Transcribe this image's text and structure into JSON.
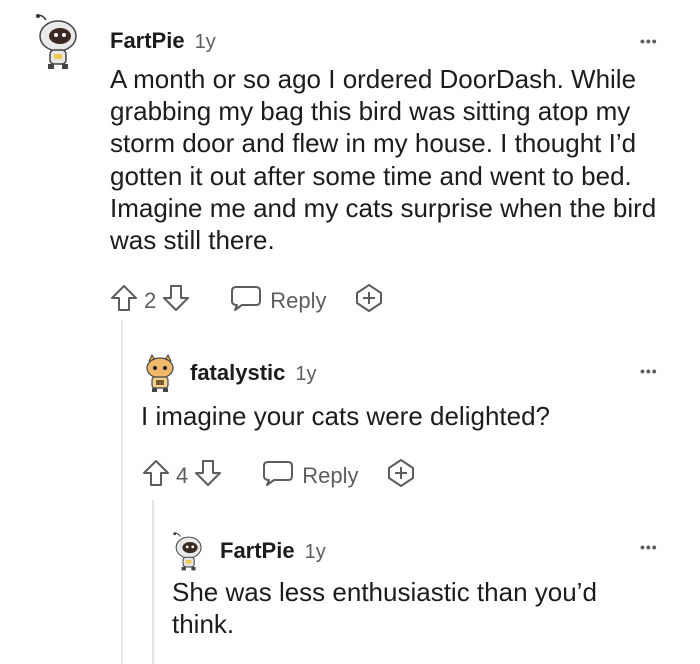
{
  "comments": [
    {
      "username": "FartPie",
      "age": "1y",
      "body": "A month or so ago I ordered DoorDash. While grabbing my bag this bird was sitting atop my storm door and flew in my house. I thought I’d gotten it out after some time and went to bed. Imagine me and my cats surprise when the bird was still there.",
      "votes": "2",
      "reply_label": "Reply",
      "more_label": "•••"
    },
    {
      "username": "fatalystic",
      "age": "1y",
      "body": "I imagine your cats were delighted?",
      "votes": "4",
      "reply_label": "Reply",
      "more_label": "•••"
    },
    {
      "username": "FartPie",
      "age": "1y",
      "body": "She was less enthusiastic than you’d think.",
      "more_label": "•••"
    }
  ],
  "colors": {
    "text": "#1c1c1c",
    "muted": "#5d5d5d",
    "thread_line": "#e5e5e5"
  },
  "icons": [
    "snoo-astronaut-avatar",
    "snoo-cat-avatar",
    "upvote-icon",
    "downvote-icon",
    "reply-icon",
    "award-icon",
    "more-options-icon"
  ]
}
